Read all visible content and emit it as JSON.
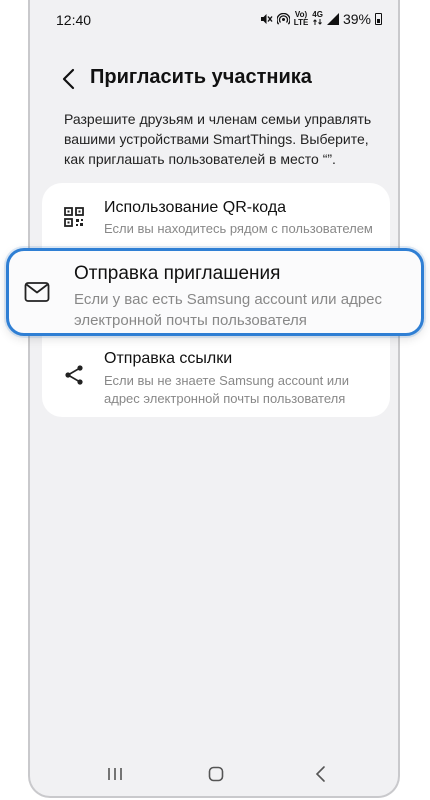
{
  "status_bar": {
    "time": "12:40",
    "network_top": "Vo)",
    "network_bottom": "LTE",
    "signal_gen": "4G",
    "battery_percent": "39%"
  },
  "header": {
    "title": "Пригласить участника"
  },
  "description": "Разрешите друзьям и членам семьи управлять вашими устройствами SmartThings. Выберите, как приглашать пользователей в место “”.",
  "options": [
    {
      "icon": "qr-code-icon",
      "title": "Использование QR-кода",
      "desc": "Если вы находитесь рядом с пользователем"
    },
    {
      "icon": "mail-icon",
      "title": "Отправка приглашения",
      "desc": "Если у вас есть Samsung account или адрес электронной почты пользователя"
    },
    {
      "icon": "share-icon",
      "title": "Отправка ссылки",
      "desc": "Если вы не знаете Samsung account или адрес электронной почты пользователя"
    }
  ],
  "colors": {
    "highlight_border": "#2f7fd4",
    "background": "#f1f1f3",
    "card": "#ffffff"
  },
  "nav_bar": {
    "icons": [
      "recents-icon",
      "home-icon",
      "back-icon"
    ]
  }
}
